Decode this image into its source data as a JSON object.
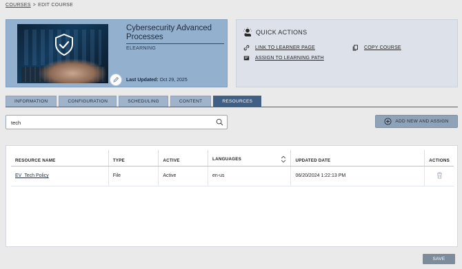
{
  "breadcrumb": {
    "parent": "COURSES",
    "separator": ">",
    "current": "EDIT COURSE"
  },
  "course": {
    "title": "Cybersecurity Advanced Processes",
    "type": "ELEARNING",
    "last_updated_label": "Last Updated:",
    "last_updated_value": "Oct 29, 2025"
  },
  "quick_actions": {
    "title": "QUICK ACTIONS",
    "links": [
      {
        "label": "LINK TO LEARNER PAGE",
        "icon": "link-icon"
      },
      {
        "label": "COPY COURSE",
        "icon": "copy-icon"
      },
      {
        "label": "ASSIGN TO LEARNING PATH",
        "icon": "path-icon"
      }
    ]
  },
  "tabs": [
    {
      "label": "INFORMATION",
      "active": false
    },
    {
      "label": "CONFIGURATION",
      "active": false
    },
    {
      "label": "SCHEDULING",
      "active": false
    },
    {
      "label": "CONTENT",
      "active": false
    },
    {
      "label": "RESOURCES",
      "active": true
    }
  ],
  "search": {
    "value": "tech",
    "placeholder": ""
  },
  "add_button": {
    "label": "ADD NEW AND ASSIGN"
  },
  "table": {
    "headers": [
      "RESOURCE NAME",
      "TYPE",
      "ACTIVE",
      "LANGUAGES",
      "UPDATED DATE",
      "ACTIONS"
    ],
    "rows": [
      {
        "name": "EV_Tech Policy",
        "type": "File",
        "active": "Active",
        "languages": "en-us",
        "updated": "06/20/2024 1:22:13 PM"
      }
    ]
  },
  "save_button": {
    "label": "SAVE"
  },
  "colors": {
    "card": "#93b0cf",
    "active_tab": "#3f5f85",
    "tab": "#9fb4cb"
  }
}
